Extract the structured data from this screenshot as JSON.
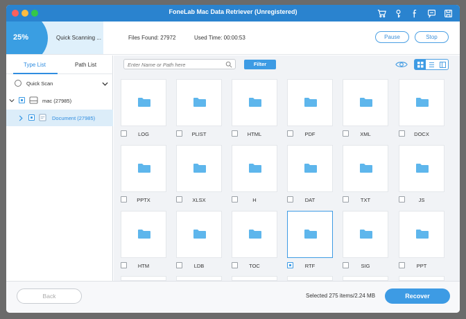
{
  "window": {
    "title": "FoneLab Mac Data Retriever (Unregistered)",
    "traffic_colors": [
      "#fc605c",
      "#fdbc40",
      "#34c84a"
    ],
    "title_icons": [
      "cart-icon",
      "key-icon",
      "facebook-icon",
      "chat-icon",
      "save-icon"
    ]
  },
  "status": {
    "progress_percent": 25,
    "progress_label": "25%",
    "scan_label": "Quick Scanning ...",
    "files_found": "Files Found: 27972",
    "used_time": "Used Time: 00:00:53",
    "pause_label": "Pause",
    "stop_label": "Stop"
  },
  "sidebar": {
    "tabs": [
      {
        "label": "Type List",
        "active": true
      },
      {
        "label": "Path List",
        "active": false
      }
    ],
    "quick_scan_label": "Quick Scan",
    "drive_label": "mac (27985)",
    "folder_label": "Document (27985)"
  },
  "toolbar": {
    "search_placeholder": "Enter Name or Path here",
    "filter_label": "Filter"
  },
  "files": [
    {
      "label": "LOG",
      "checked": false,
      "selected": false
    },
    {
      "label": "PLIST",
      "checked": false,
      "selected": false
    },
    {
      "label": "HTML",
      "checked": false,
      "selected": false
    },
    {
      "label": "PDF",
      "checked": false,
      "selected": false
    },
    {
      "label": "XML",
      "checked": false,
      "selected": false
    },
    {
      "label": "DOCX",
      "checked": false,
      "selected": false
    },
    {
      "label": "PPTX",
      "checked": false,
      "selected": false
    },
    {
      "label": "XLSX",
      "checked": false,
      "selected": false
    },
    {
      "label": "H",
      "checked": false,
      "selected": false
    },
    {
      "label": "DAT",
      "checked": false,
      "selected": false
    },
    {
      "label": "TXT",
      "checked": false,
      "selected": false
    },
    {
      "label": "JS",
      "checked": false,
      "selected": false
    },
    {
      "label": "HTM",
      "checked": false,
      "selected": false
    },
    {
      "label": "LDB",
      "checked": false,
      "selected": false
    },
    {
      "label": "TOC",
      "checked": false,
      "selected": false
    },
    {
      "label": "RTF",
      "checked": true,
      "selected": true
    },
    {
      "label": "SIG",
      "checked": false,
      "selected": false
    },
    {
      "label": "PPT",
      "checked": false,
      "selected": false
    }
  ],
  "footer": {
    "back_label": "Back",
    "selected_info": "Selected 275 items/2.24 MB",
    "recover_label": "Recover"
  },
  "colors": {
    "accent": "#3d9be4",
    "titlebar": "#2a83cf",
    "folder": "#5eb6ec"
  }
}
